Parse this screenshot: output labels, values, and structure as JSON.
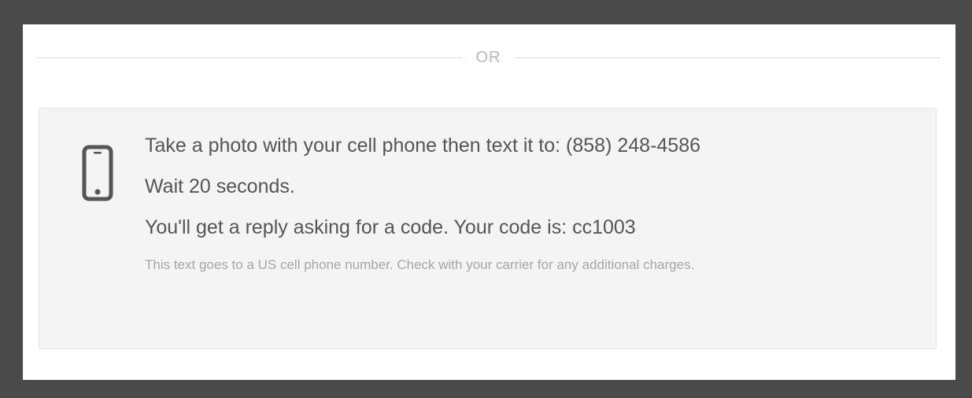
{
  "divider": {
    "label": "OR"
  },
  "sms_option": {
    "icon": "phone-icon",
    "instructions": [
      "Take a photo with your cell phone then text it to: (858) 248-4586",
      "Wait 20 seconds.",
      "You'll get a reply asking for a code. Your code is: cc1003"
    ],
    "note": "This text goes to a US cell phone number. Check with your carrier for any additional charges."
  },
  "colors": {
    "frame": "#4a4a4a",
    "panel": "#ffffff",
    "card": "#f4f4f4",
    "text": "#555555",
    "muted": "#a6a6a6"
  }
}
